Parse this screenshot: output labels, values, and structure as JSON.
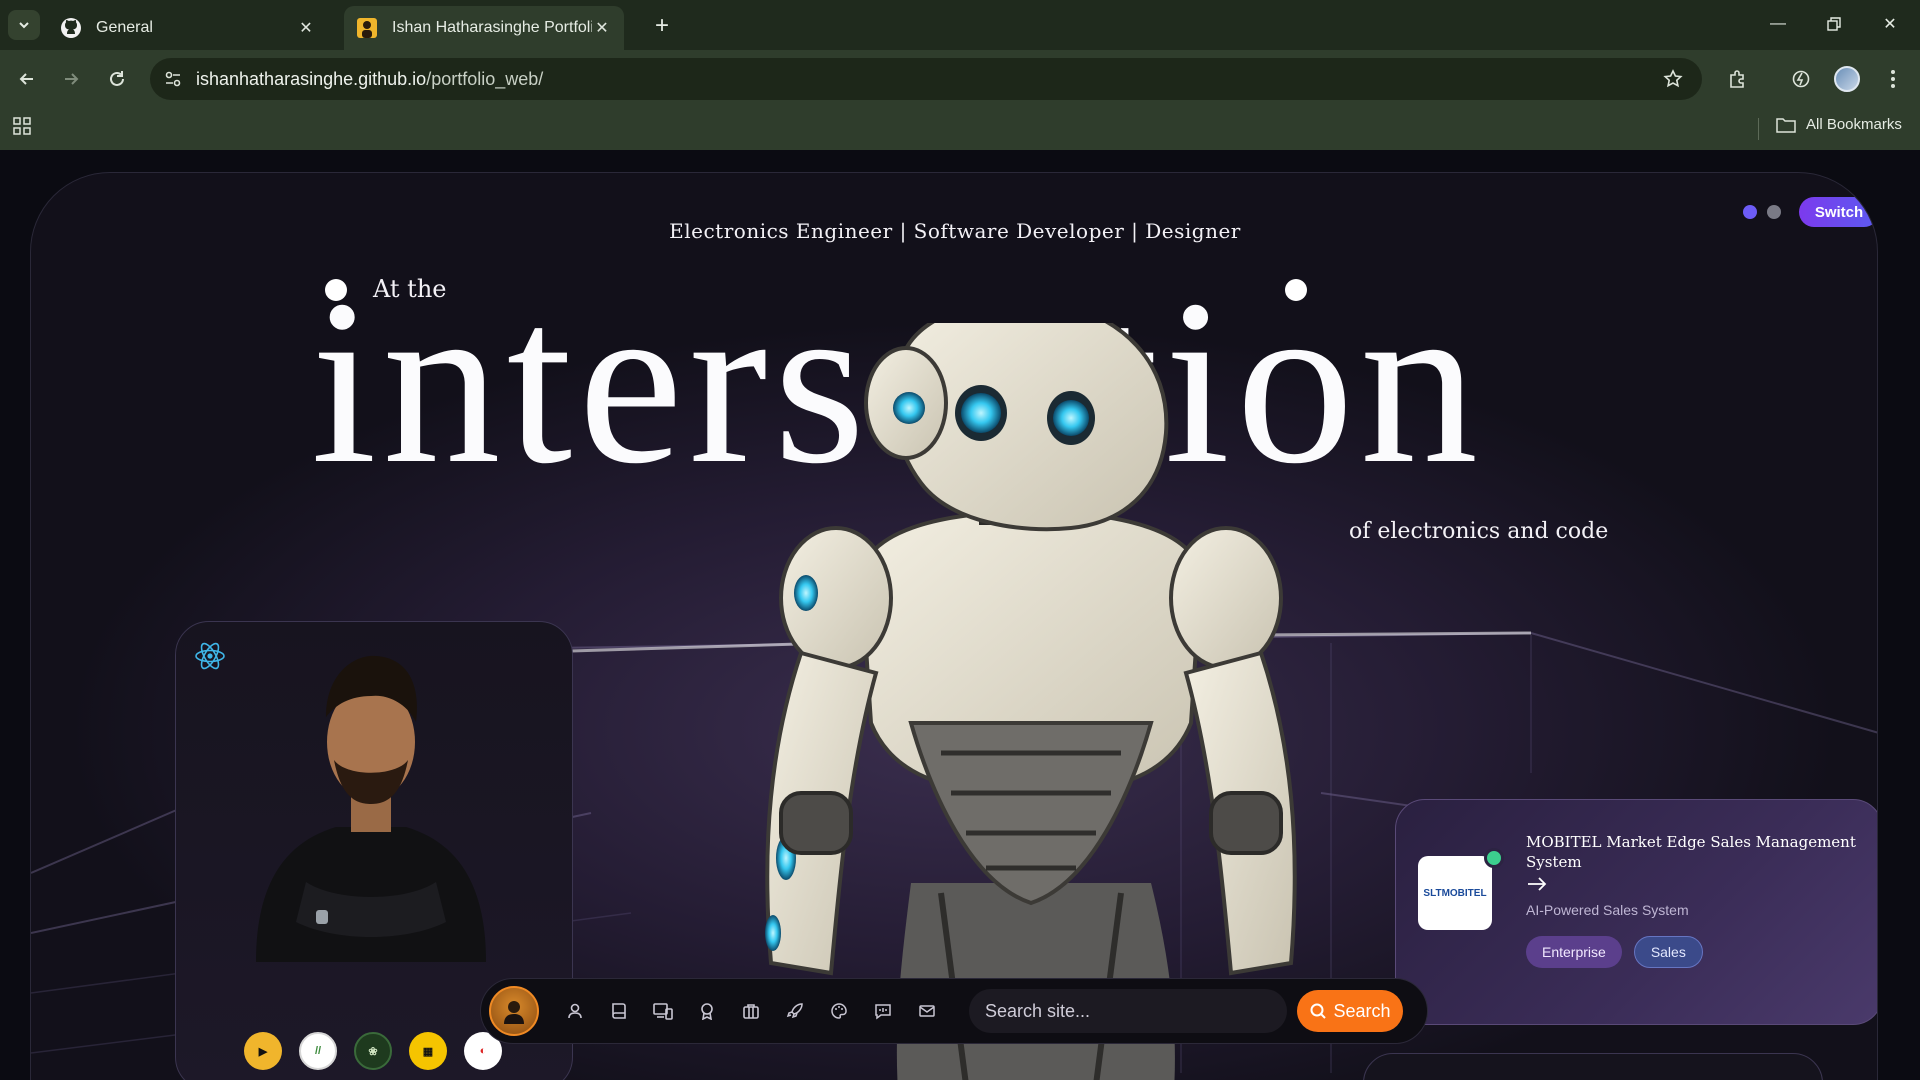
{
  "browser": {
    "tabs": [
      {
        "title": "General",
        "favicon": "github-icon",
        "active": false
      },
      {
        "title": "Ishan Hatharasinghe Portfolio",
        "favicon": "portfolio-favicon",
        "active": true
      }
    ],
    "url_host": "ishanhatharasinghe.github.io",
    "url_path": "/portfolio_web/",
    "bookmarks_label": "All Bookmarks"
  },
  "hero": {
    "tagline": "Electronics Engineer | Software Developer | Designer",
    "switch_label": "Switch",
    "at_the": "At the",
    "big_word": "intersection",
    "subline": "of electronics and code",
    "dot_colors": [
      "#6d5cf6",
      "#7a7a86"
    ]
  },
  "dock": {
    "icons": [
      "user-icon",
      "book-icon",
      "devices-icon",
      "award-icon",
      "briefcase-icon",
      "rocket-icon",
      "palette-icon",
      "chat-icon",
      "mail-icon"
    ],
    "search_placeholder": "Search site...",
    "search_button": "Search"
  },
  "project": {
    "title": "MOBITEL Market Edge Sales Management System",
    "subtitle": "AI-Powered Sales System",
    "thumb_text": "SLTMOBITEL",
    "tags": [
      "Enterprise",
      "Sales"
    ]
  },
  "colors": {
    "accent": "#7c3aed",
    "search_orange": "#f97316",
    "chrome_bg": "#2f3d2c"
  }
}
